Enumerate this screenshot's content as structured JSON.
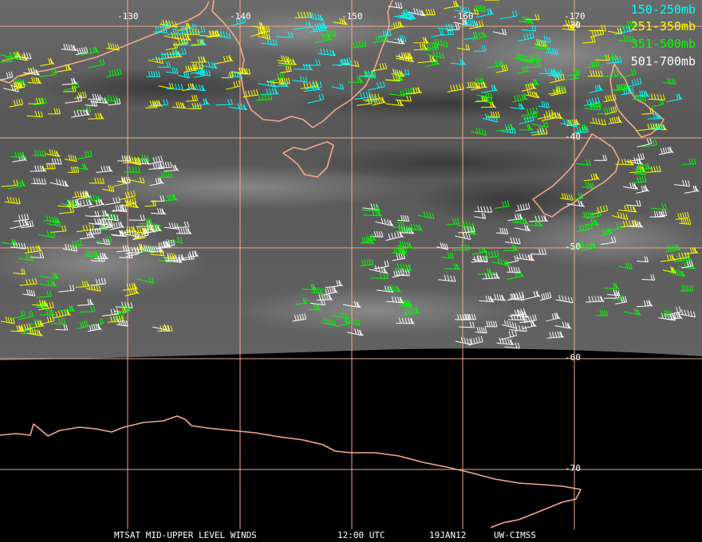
{
  "legend": [
    {
      "text": "150-250mb",
      "color": "#00ffff"
    },
    {
      "text": "251-350mb",
      "color": "#ffff00"
    },
    {
      "text": "351-500mb",
      "color": "#00ff00"
    },
    {
      "text": "501-700mb",
      "color": "#ffffff"
    }
  ],
  "longitude_labels": [
    "-130",
    "-140",
    "-150",
    "-160",
    "-170"
  ],
  "latitude_labels": [
    "-30",
    "-40",
    "-50",
    "-60",
    "-70"
  ],
  "footer": {
    "product": "MTSAT MID-UPPER LEVEL WINDS",
    "time": "12:00 UTC",
    "date": "19JAN12",
    "source": "UW-CIMSS"
  },
  "colors": {
    "coastline": "#f4a98a",
    "gridline": "#f4a98a",
    "background": "#000000"
  }
}
